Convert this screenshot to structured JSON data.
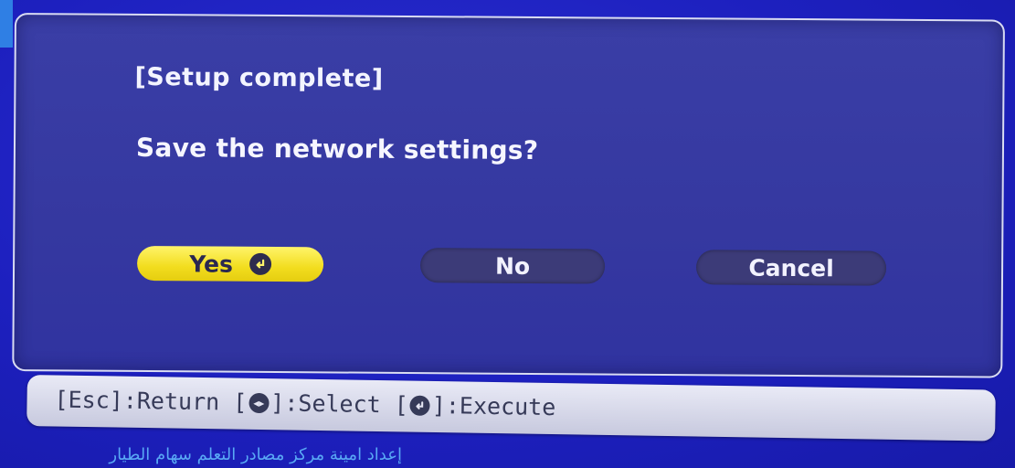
{
  "dialog": {
    "title": "[Setup complete]",
    "message": "Save the network settings?"
  },
  "buttons": {
    "yes_label": "Yes",
    "no_label": "No",
    "cancel_label": "Cancel",
    "selected": "yes",
    "yes_icon": "enter-icon"
  },
  "help_bar": {
    "esc_key": "[Esc]",
    "esc_action": ":Return",
    "select_key_open": "[",
    "select_key_icon": "left-right-arrows-icon",
    "select_key_close": "]",
    "select_action": ":Select",
    "execute_key_open": "[",
    "execute_key_icon": "enter-icon",
    "execute_key_close": "]",
    "execute_action": ":Execute"
  },
  "watermark": {
    "text": "إعداد امينة مركز مصادر التعلم سهام الطيار"
  },
  "colors": {
    "screen_background": "#1b1cb8",
    "dialog_background": "#3538a0",
    "selected_button": "#f2dd1e",
    "unselected_button": "#3c3b78",
    "help_bar": "#d8d9ea",
    "watermark_text": "#59a9f5"
  }
}
